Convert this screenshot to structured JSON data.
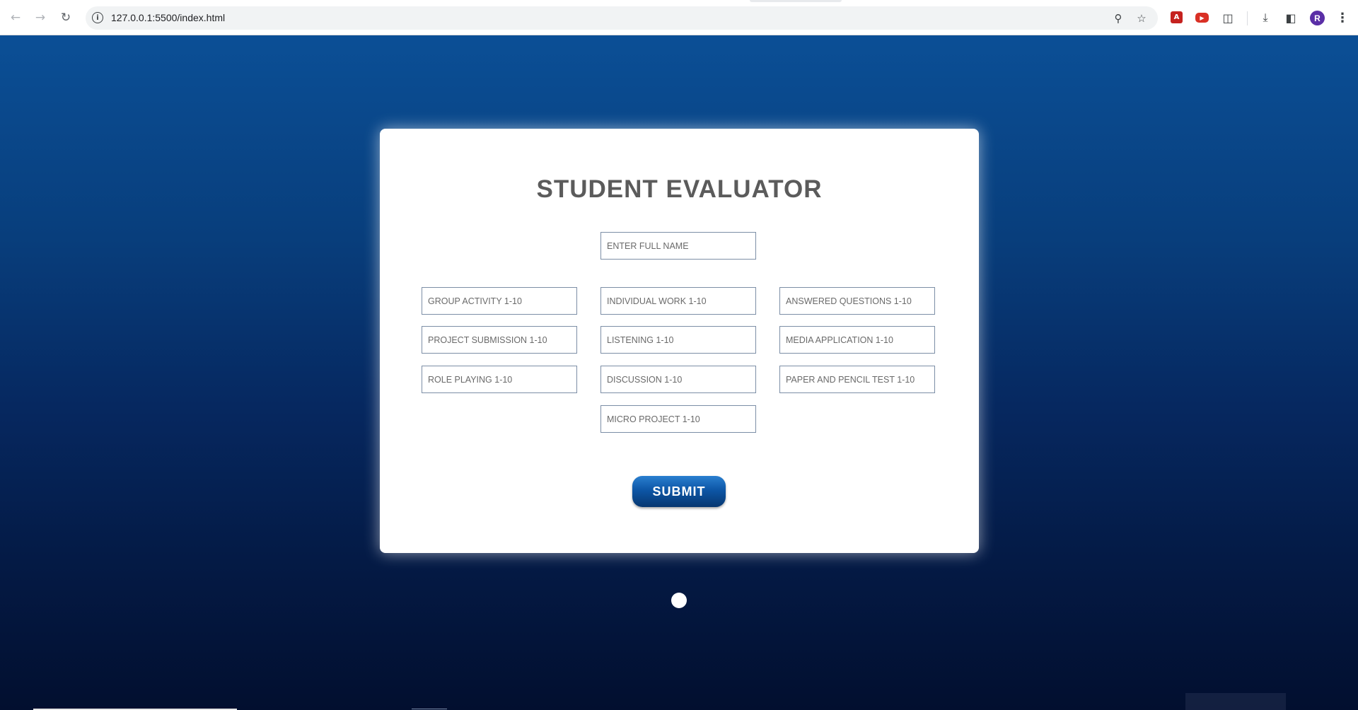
{
  "browser": {
    "url": "127.0.0.1:5500/index.html",
    "profile_initial": "R",
    "icons": {
      "back": "back-arrow-icon",
      "forward": "forward-arrow-icon",
      "reload": "reload-icon",
      "site_info": "info-icon",
      "zoom": "zoom-icon",
      "bookmark": "star-icon",
      "pdf_extension": "pdf-icon",
      "video_extension": "video-icon",
      "extensions": "puzzle-icon",
      "downloads": "download-icon",
      "side_panel": "side-panel-icon",
      "menu": "kebab-menu-icon"
    }
  },
  "form": {
    "title": "STUDENT EVALUATOR",
    "name_placeholder": "ENTER FULL NAME",
    "fields": {
      "group_activity": "GROUP ACTIVITY 1-10",
      "individual_work": "INDIVIDUAL WORK 1-10",
      "answered_questions": "ANSWERED QUESTIONS 1-10",
      "project_submission": "PROJECT SUBMISSION 1-10",
      "listening": "LISTENING 1-10",
      "media_application": "MEDIA APPLICATION 1-10",
      "role_playing": "ROLE PLAYING 1-10",
      "discussion": "DISCUSSION 1-10",
      "paper_pencil_test": "PAPER AND PENCIL TEST 1-10",
      "micro_project": "MICRO PROJECT 1-10"
    },
    "submit_label": "SUBMIT"
  },
  "colors": {
    "page_gradient_top": "#0b4f96",
    "page_gradient_bottom": "#020f2f",
    "title": "#5b5b5b",
    "button": "#0d56a6",
    "field_border": "#7c8ea6"
  }
}
